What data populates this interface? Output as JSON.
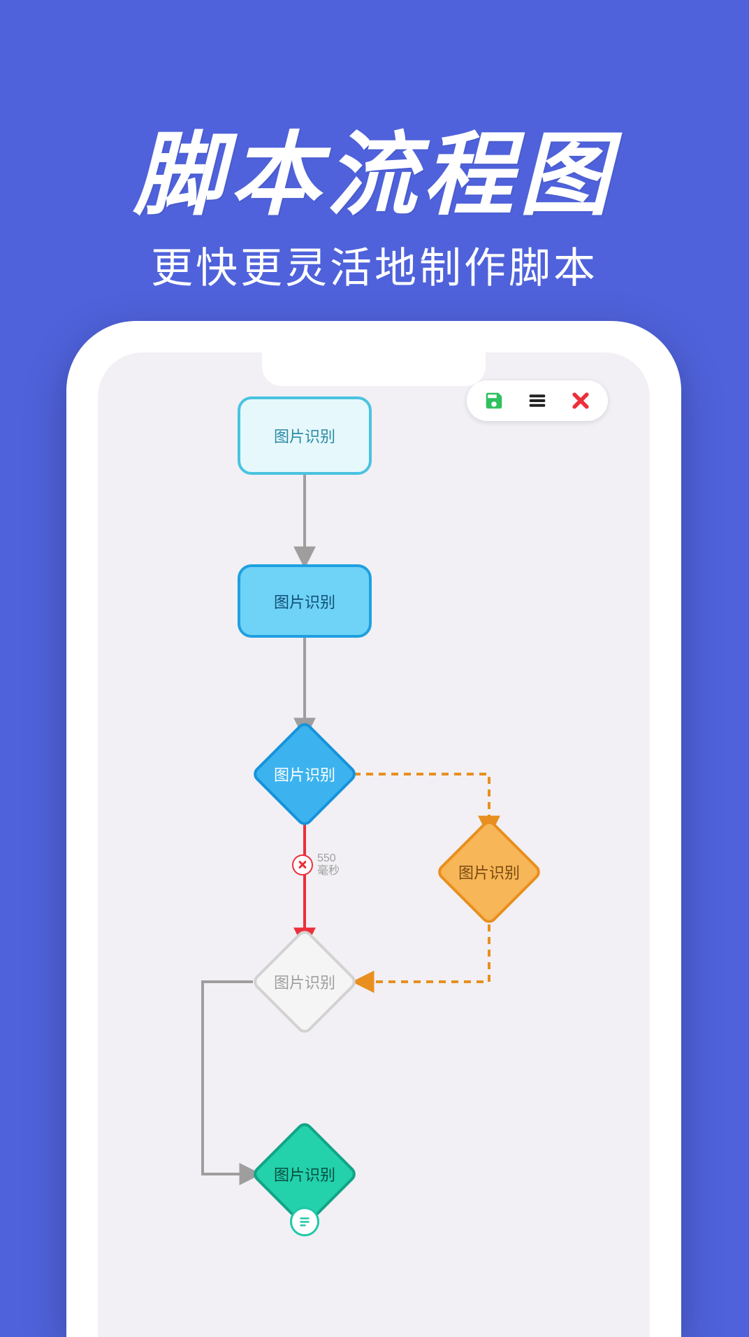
{
  "marketing": {
    "title": "脚本流程图",
    "subtitle": "更快更灵活地制作脚本"
  },
  "toolbar": {
    "save_icon": "save-icon",
    "menu_icon": "menu-icon",
    "close_icon": "close-icon"
  },
  "colors": {
    "bg": "#4f62db",
    "screen": "#f2f0f4",
    "node_light_fill": "#e6f8fb",
    "node_light_stroke": "#49c3e0",
    "node_blue_fill": "#6fd3f7",
    "node_blue_stroke": "#1fa0e0",
    "diamond_blue_fill": "#3cb3ef",
    "diamond_blue_stroke": "#1693db",
    "diamond_orange_fill": "#f7b657",
    "diamond_orange_stroke": "#e88f1f",
    "diamond_grey_fill": "#f5f5f5",
    "diamond_grey_stroke": "#d2d2d2",
    "diamond_teal_fill": "#23d1ab",
    "diamond_teal_stroke": "#12a487",
    "edge_grey": "#9e9e9e",
    "edge_red": "#ec2f3b",
    "edge_orange": "#e88f1f",
    "toolbar_save": "#2fc05f",
    "toolbar_menu": "#222222",
    "toolbar_close": "#ec2f3b"
  },
  "nodes": {
    "n1": {
      "label": "图片识别",
      "label_color": "#2a8aa6"
    },
    "n2": {
      "label": "图片识别",
      "label_color": "#0f4f77"
    },
    "n3": {
      "label": "图片识别",
      "label_color": "#ffffff"
    },
    "n4": {
      "label": "图片识别",
      "label_color": "#7a4a10"
    },
    "n5": {
      "label": "图片识别",
      "label_color": "#9e9e9e"
    },
    "n6": {
      "label": "图片识别",
      "label_color": "#064f40"
    }
  },
  "delay_badge": {
    "value": "550",
    "unit": "毫秒"
  }
}
